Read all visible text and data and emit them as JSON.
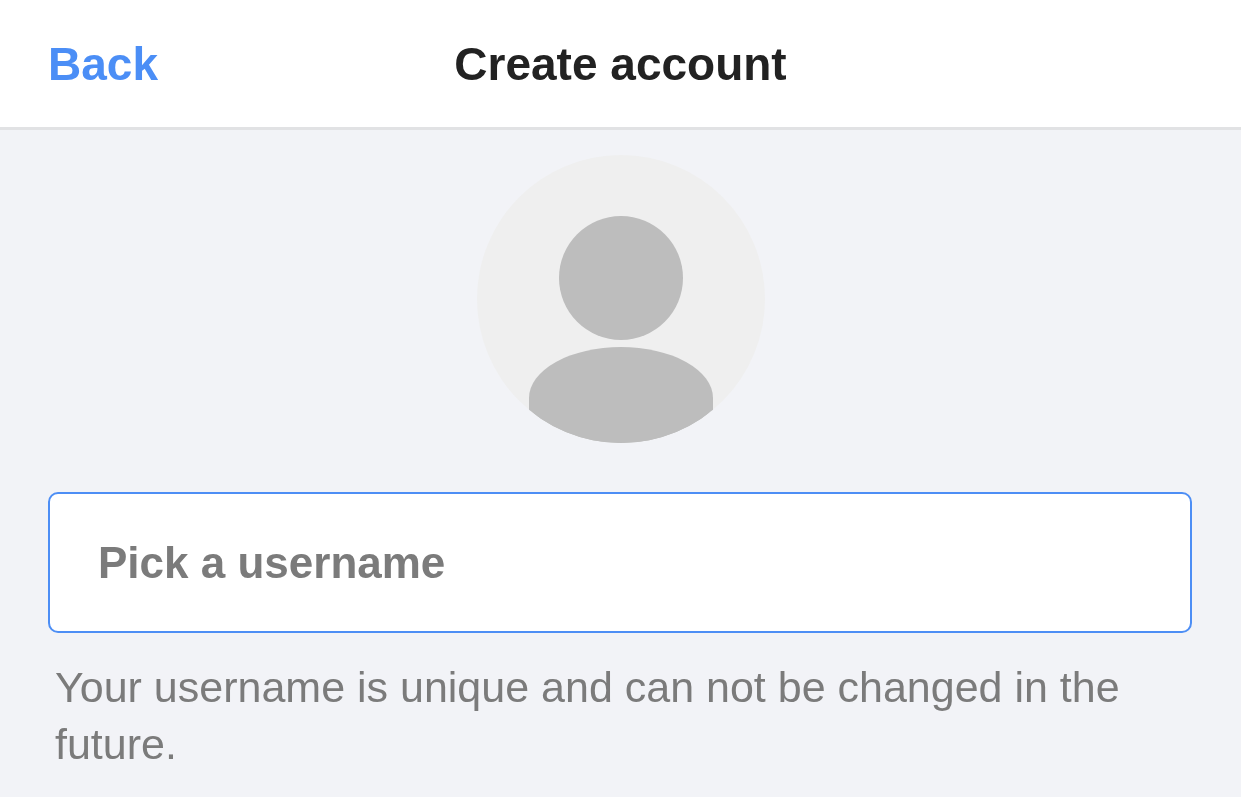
{
  "nav_bar": {
    "back": "Back",
    "title": "Create account"
  },
  "username_field": {
    "placeholder": "Pick a username",
    "focused": true
  },
  "helper_text": "Your username is unique and can not be changed in the future."
}
